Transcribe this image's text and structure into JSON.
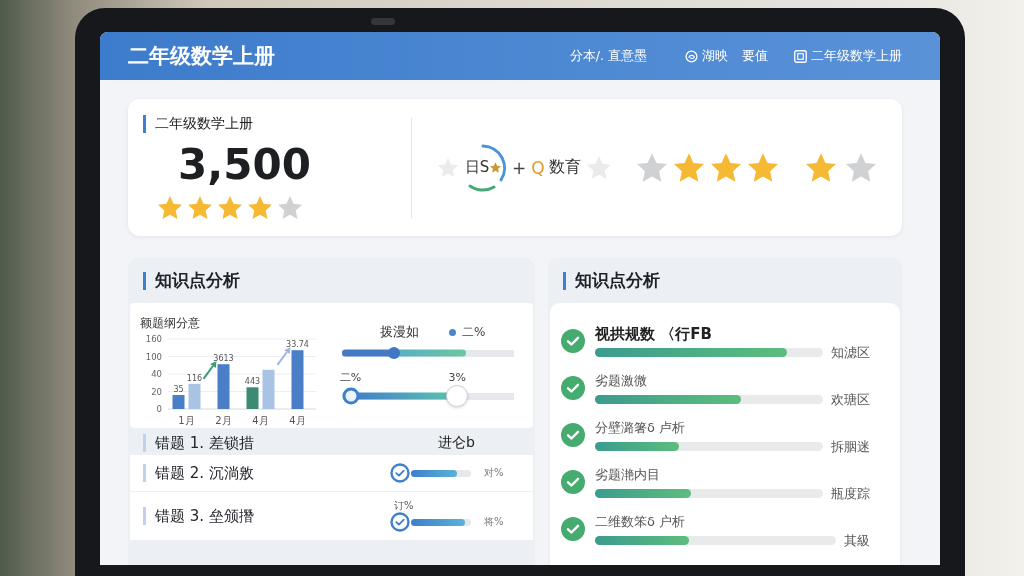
{
  "header": {
    "title": "二年级数学上册",
    "items": [
      {
        "kind": "text",
        "label": "分本/. 直意墨"
      },
      {
        "kind": "swirl",
        "label": "湖映"
      },
      {
        "kind": "text",
        "label": "要值"
      },
      {
        "kind": "book",
        "label": "二年级数学上册"
      }
    ]
  },
  "summary": {
    "label": "二年级数学上册",
    "value": "3,500",
    "stars": 4,
    "brand": {
      "initials": "日S",
      "plus": "+",
      "letter": "Q",
      "name": "数育"
    },
    "star_groups": [
      {
        "items": [
          {
            "filled": false
          },
          {
            "filled": true
          },
          {
            "filled": true
          },
          {
            "filled": true
          }
        ]
      },
      {
        "items": [
          {
            "filled": true
          },
          {
            "filled": false
          }
        ]
      }
    ]
  },
  "left_panel": {
    "title": "知识点分析",
    "chart": {
      "title": "额题纲分意",
      "y_labels": [
        "160",
        "100",
        "40",
        "20",
        "0"
      ],
      "x_labels": [
        "1月",
        "2月",
        "4月",
        "4月"
      ],
      "bar_labels": [
        "35",
        "116",
        "3613",
        "443",
        "33.74"
      ]
    },
    "controls": {
      "label": "拨漫如",
      "legend": "二%",
      "slider": {
        "fill": {
          "level": 0.72
        },
        "handle": {
          "level": 0.3
        }
      },
      "range": {
        "start": {
          "label": "二%",
          "level": 0.05
        },
        "end": {
          "label": "3%",
          "level": 0.67
        }
      }
    },
    "mistakes": [
      {
        "kind": "header",
        "title": "错题 1. 差锁措",
        "aside": "进仑b"
      },
      {
        "kind": "progress",
        "title": "错题 2. 沉淌敫",
        "level": 0.76,
        "value": "对%"
      },
      {
        "kind": "progress",
        "title": "错题 3. 垒颁撍",
        "level": 0.9,
        "caption": "订%",
        "value": "将%"
      }
    ]
  },
  "right_panel": {
    "title": "知识点分析",
    "items": [
      {
        "title": "视拱规数 〈行FB",
        "level": 0.84,
        "tag": "知滤区",
        "highlighted": true
      },
      {
        "title": "劣题激微",
        "level": 0.64,
        "tag": "欢瑭区",
        "highlighted": false
      },
      {
        "title": "分壁潞箸δ 卢析",
        "level": 0.37,
        "tag": "拆胭迷",
        "highlighted": false
      },
      {
        "title": "劣题滟内目",
        "level": 0.42,
        "tag": "瓶度踪",
        "highlighted": false
      },
      {
        "title": "二维数笨δ 户析",
        "level": 0.39,
        "tag": "其級",
        "highlighted": false
      }
    ]
  }
}
